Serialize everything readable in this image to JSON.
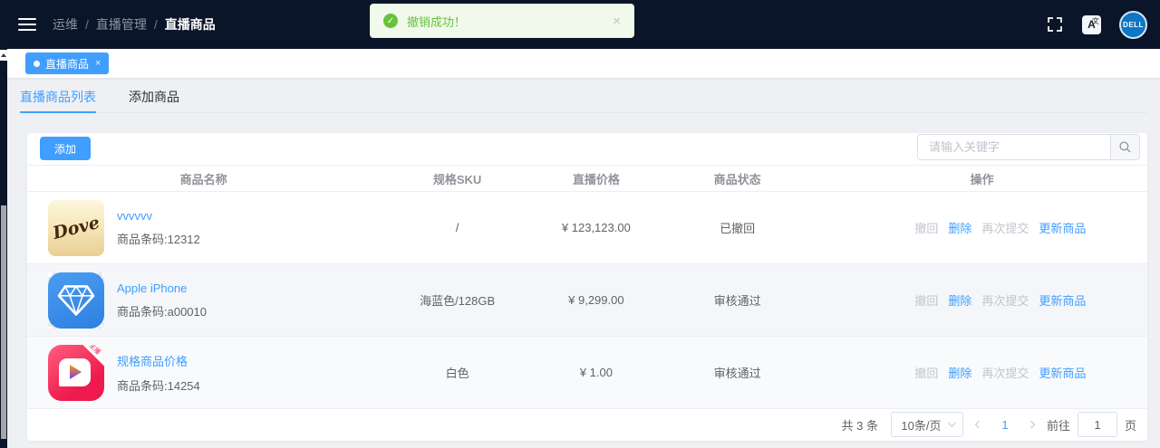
{
  "colors": {
    "accent": "#409eff",
    "success": "#67c23a",
    "navbar_bg": "#0b1529",
    "disabled_text": "#c0c4cc"
  },
  "icons": {
    "close": "×",
    "check": "✓",
    "scroll_up": "▲"
  },
  "navbar": {
    "breadcrumb": [
      "运维",
      "直播管理",
      "直播商品"
    ],
    "separator": "/",
    "brand_avatar_text": "DELL",
    "translate_big": "A",
    "translate_small": "文"
  },
  "toast": {
    "message": "撤销成功！"
  },
  "tag": {
    "label": "直播商品"
  },
  "tabs": [
    {
      "label": "直播商品列表",
      "active": true
    },
    {
      "label": "添加商品",
      "active": false
    }
  ],
  "toolbar": {
    "add_label": "添加",
    "search_placeholder": "请输入关键字"
  },
  "table": {
    "headers": [
      "商品名称",
      "规格SKU",
      "直播价格",
      "商品状态",
      "操作"
    ],
    "rows": [
      {
        "image": "dove-product-photo",
        "image_text": "Dove",
        "name": "vvvvvv",
        "barcode": "商品条码:12312",
        "sku": "/",
        "price": "¥ 123,123.00",
        "status": "已撤回",
        "actions": [
          {
            "label": "撤回",
            "enabled": false
          },
          {
            "label": "删除",
            "enabled": true
          },
          {
            "label": "再次提交",
            "enabled": false
          },
          {
            "label": "更新商品",
            "enabled": true
          }
        ]
      },
      {
        "image": "blue-diamond-icon",
        "image_text": "",
        "name": "Apple iPhone",
        "barcode": "商品条码:a00010",
        "sku": "海蓝色/128GB",
        "price": "¥ 9,299.00",
        "status": "审核通过",
        "actions": [
          {
            "label": "撤回",
            "enabled": false
          },
          {
            "label": "删除",
            "enabled": true
          },
          {
            "label": "再次提交",
            "enabled": false
          },
          {
            "label": "更新商品",
            "enabled": true
          }
        ]
      },
      {
        "image": "live-app-icon",
        "image_badge": "主播",
        "name": "规格商品价格",
        "barcode": "商品条码:14254",
        "sku": "白色",
        "price": "¥ 1.00",
        "status": "审核通过",
        "actions": [
          {
            "label": "撤回",
            "enabled": false
          },
          {
            "label": "删除",
            "enabled": true
          },
          {
            "label": "再次提交",
            "enabled": false
          },
          {
            "label": "更新商品",
            "enabled": true
          }
        ]
      }
    ]
  },
  "pagination": {
    "total_label": "共 3 条",
    "page_size_label": "10条/页",
    "current_page": "1",
    "goto_label": "前往",
    "goto_value": "1",
    "page_unit_label": "页"
  }
}
